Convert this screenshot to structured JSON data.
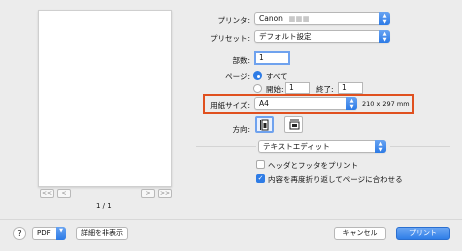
{
  "preview": {
    "nav_first": "<<",
    "nav_prev": "<",
    "nav_next": ">",
    "nav_last": ">>",
    "page_indicator": "1 / 1"
  },
  "printer": {
    "label": "プリンタ:",
    "value": "Canon",
    "redacted_suffix": "■■■"
  },
  "presets": {
    "label": "プリセット:",
    "value": "デフォルト設定"
  },
  "copies": {
    "label": "部数:",
    "value": "1"
  },
  "pages": {
    "label": "ページ:",
    "all_label": "すべて",
    "from_label": "開始:",
    "from_value": "1",
    "to_label": "終了:",
    "to_value": "1",
    "selected": "all"
  },
  "paper_size": {
    "label": "用紙サイズ:",
    "value": "A4",
    "dimensions": "210 x 297 mm"
  },
  "orientation": {
    "label": "方向:",
    "selected": "portrait"
  },
  "app_section": {
    "value": "テキストエディット"
  },
  "options": [
    {
      "label": "ヘッダとフッタをプリント",
      "checked": false
    },
    {
      "label": "内容を再度折り返してページに合わせる",
      "checked": true
    }
  ],
  "bottom": {
    "help": "?",
    "pdf_label": "PDF",
    "hide_details": "詳細を非表示",
    "cancel": "キャンセル",
    "print": "プリント"
  },
  "colors": {
    "accent": "#2e7ce6",
    "highlight_box": "#e0501f"
  }
}
